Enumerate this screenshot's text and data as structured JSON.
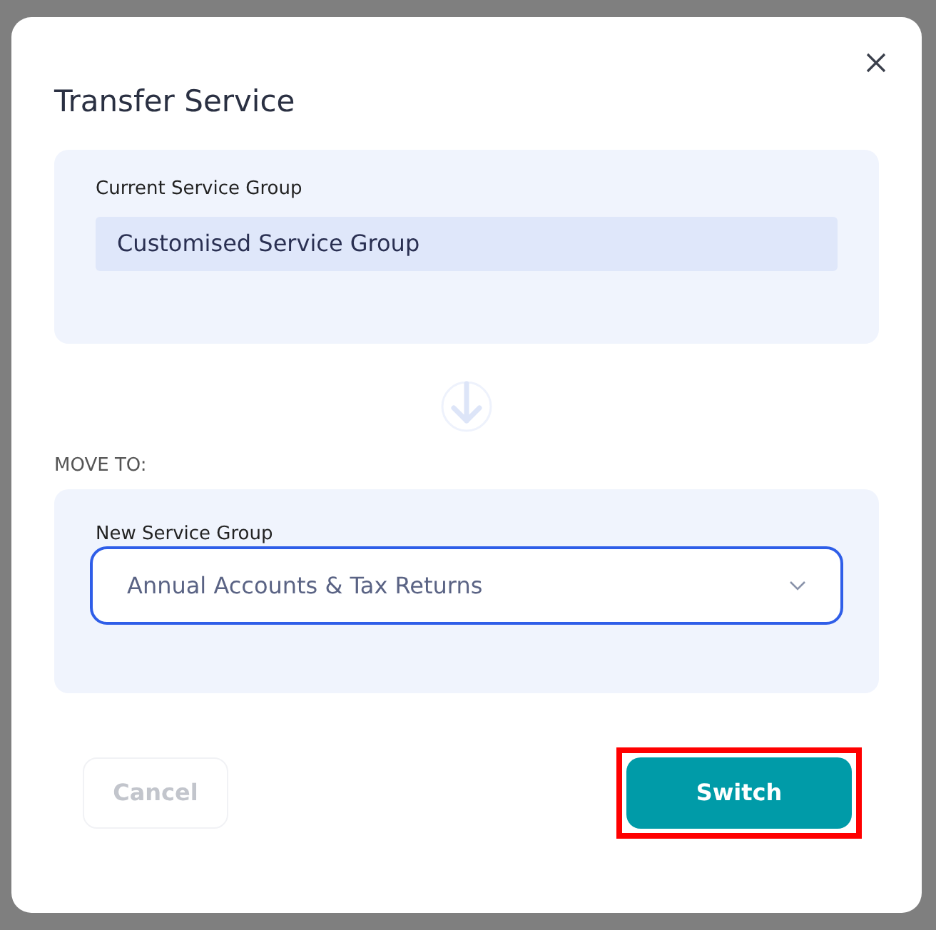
{
  "dialog": {
    "title": "Transfer Service"
  },
  "current": {
    "label": "Current Service Group",
    "value": "Customised Service Group"
  },
  "move_to": {
    "heading": "MOVE TO:",
    "label": "New Service Group",
    "value": "Annual Accounts & Tax Returns",
    "focused": true
  },
  "buttons": [
    {
      "label": "Cancel",
      "kind": "secondary",
      "disabled": true,
      "highlighted": false
    },
    {
      "label": "Switch",
      "kind": "primary",
      "disabled": false,
      "highlighted": true
    }
  ]
}
